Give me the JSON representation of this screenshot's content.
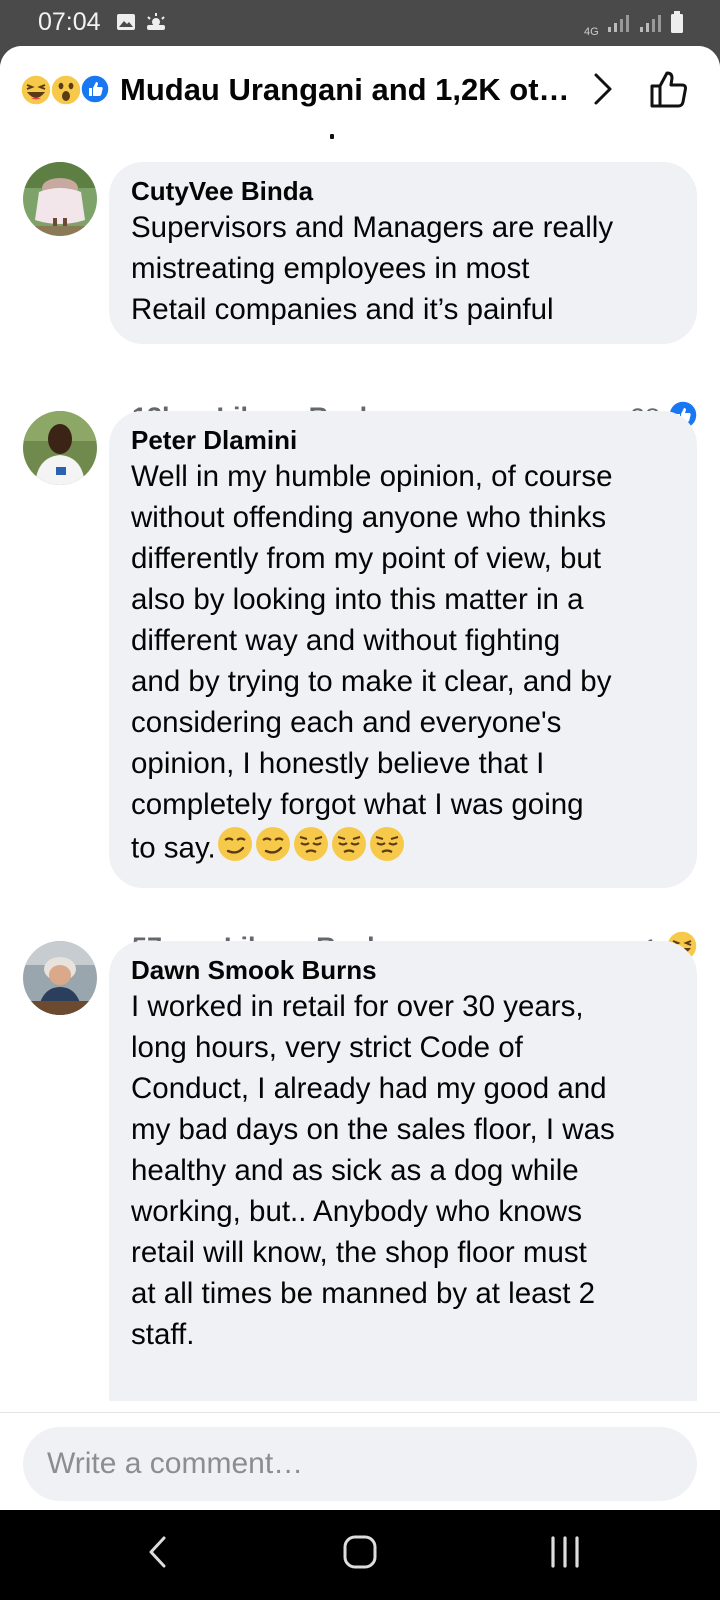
{
  "status_bar": {
    "time": "07:04",
    "network": "4G"
  },
  "header": {
    "reactions": [
      "laugh-reaction",
      "wow-reaction",
      "like-reaction"
    ],
    "title": "Mudau Urangani and 1,2K ot…"
  },
  "comments": [
    {
      "author": "CutyVee Binda",
      "text": "Supervisors and Managers are really\nmistreating employees in most\nRetail companies and it’s painful",
      "time": "13h",
      "like_label": "Like",
      "reply_label": "Reply",
      "reaction_count": "28",
      "reaction_type": "like-reaction"
    },
    {
      "author": "Peter Dlamini",
      "text": "Well in my humble opinion, of course\nwithout offending anyone who thinks\ndifferently from my point of view, but\nalso by looking into this matter in a\ndifferent way and without fighting\nand by trying to make it clear, and by\nconsidering each and everyone's\nopinion, I honestly believe that I\ncompletely forgot what I was going\nto say.",
      "emojis": [
        "smirk-emoji",
        "smirk-emoji",
        "pensive-emoji",
        "pensive-emoji",
        "pensive-emoji"
      ],
      "time": "57m",
      "like_label": "Like",
      "reply_label": "Reply",
      "reaction_count": "1",
      "reaction_type": "laugh-reaction"
    },
    {
      "author": "Dawn Smook Burns",
      "text": "I worked in retail for over 30 years,\nlong hours, very strict Code of\nConduct, I already had my good and\nmy bad days on the sales floor, I was\nhealthy and as sick as a dog while\nworking, but.. Anybody who knows\nretail will know, the shop floor must\nat all times be manned by at least 2\nstaff."
    }
  ],
  "composer": {
    "placeholder": "Write a comment…"
  },
  "colors": {
    "bubble": "#f0f1f5",
    "like_blue": "#1877f2",
    "emoji_yellow": "#f7c94a",
    "text": "#050505",
    "meta": "#65676b"
  }
}
